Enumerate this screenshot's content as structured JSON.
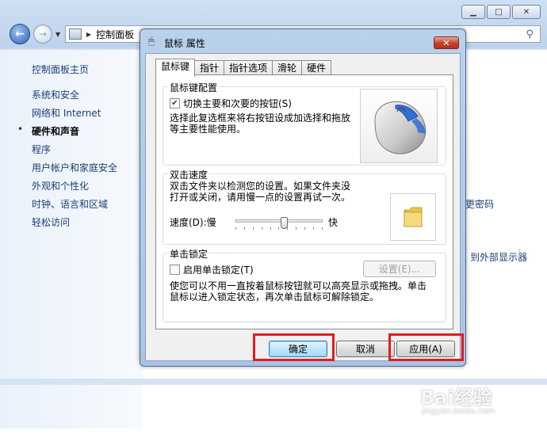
{
  "background_window": {
    "breadcrumb": "控制面板",
    "sidebar": {
      "home": "控制面板主页",
      "items": [
        "系统和安全",
        "网络和 Internet",
        "硬件和声音",
        "程序",
        "用户帐户和家庭安全",
        "外观和个性化",
        "时钟、语言和区域",
        "轻松访问"
      ],
      "active_bullet": "•"
    },
    "right_links": [
      "更改密码",
      "连接到外部显示器"
    ],
    "right_links_visible": [
      "更密码",
      "到外部显示器"
    ]
  },
  "dialog": {
    "title": "鼠标 属性",
    "close_label": "✕",
    "tabs": [
      "鼠标键",
      "指针",
      "指针选项",
      "滑轮",
      "硬件"
    ],
    "active_tab": 0,
    "button_config": {
      "group_label": "鼠标键配置",
      "checkbox_label": "切换主要和次要的按钮(S)",
      "checked": true,
      "description": [
        "选择此复选框来将右按钮设成加选择和拖放",
        "等主要性能使用。"
      ]
    },
    "double_click": {
      "group_label": "双击速度",
      "description": [
        "双击文件夹以检测您的设置。如果文件夹没",
        "打开或关闭，请用慢一点的设置再试一次。"
      ],
      "speed_label": "速度(D):慢",
      "fast_label": "快",
      "slider_value_fraction": 0.55
    },
    "click_lock": {
      "group_label": "单击锁定",
      "checkbox_label": "启用单击锁定(T)",
      "checked": false,
      "settings_button": "设置(E)...",
      "description": [
        "使您可以不用一直按着鼠标按钮就可以高亮显示或拖拽。单击",
        "鼠标以进入锁定状态，再次单击鼠标可解除锁定。"
      ]
    },
    "buttons": {
      "ok": "确定",
      "cancel": "取消",
      "apply": "应用(A)"
    }
  },
  "watermark": {
    "brand": "Bai经验",
    "url": "jingyan.baidu.com"
  },
  "colors": {
    "highlight_box": "#e21c1c",
    "link": "#1a3e76"
  }
}
